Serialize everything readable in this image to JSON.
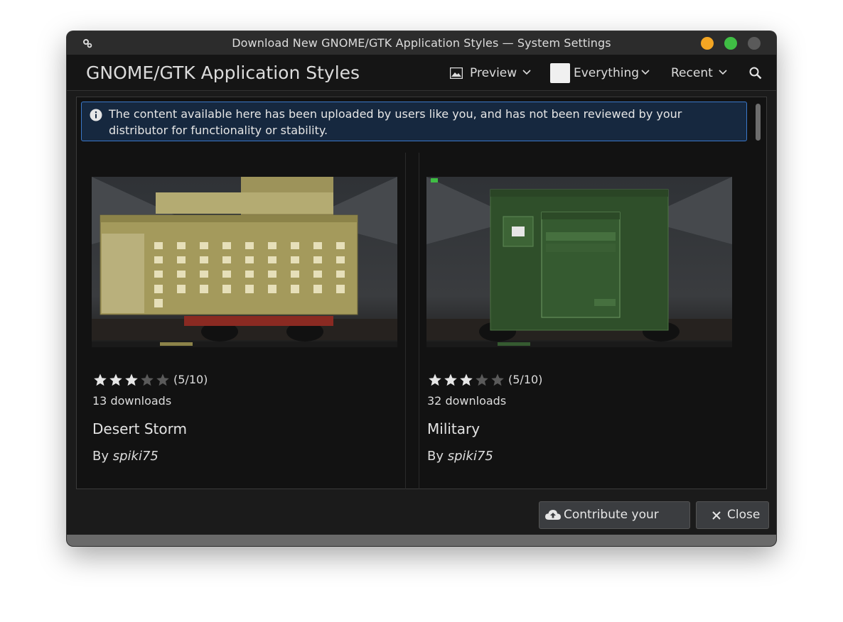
{
  "window": {
    "title": "Download New GNOME/GTK Application Styles — System Settings"
  },
  "header": {
    "page_title": "GNOME/GTK Application Styles",
    "view_label": "Preview",
    "filter_label": "Everything",
    "sort_label": "Recent"
  },
  "notice": {
    "text": "The content available here has been uploaded by users like you, and has not been reviewed by your distributor for functionality or stability."
  },
  "items": [
    {
      "rating_text": "(5/10)",
      "stars_filled": 3,
      "downloads": "13 downloads",
      "name": "Desert Storm",
      "by": "By",
      "author": "spiki75"
    },
    {
      "rating_text": "(5/10)",
      "stars_filled": 3,
      "downloads": "32 downloads",
      "name": "Military",
      "by": "By",
      "author": "spiki75"
    }
  ],
  "buttons": {
    "contribute": "Contribute your own...",
    "close": "Close"
  },
  "colors": {
    "accent": "#3a78c9",
    "minimize": "#f4a623",
    "maximize": "#3fbe44",
    "theme_desert": "#a49a5c",
    "theme_military": "#2f4f2a"
  }
}
